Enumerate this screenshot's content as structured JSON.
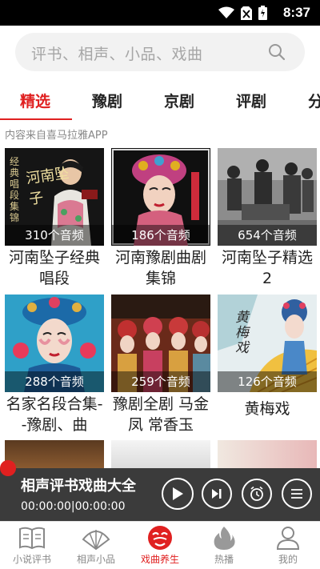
{
  "status_bar": {
    "time": "8:37"
  },
  "search": {
    "placeholder": "评书、相声、小品、戏曲"
  },
  "tabs": [
    {
      "label": "精选",
      "active": true
    },
    {
      "label": "豫剧"
    },
    {
      "label": "京剧"
    },
    {
      "label": "评剧"
    },
    {
      "label": "分"
    }
  ],
  "source_note": "内容来自喜马拉雅APP",
  "albums": [
    {
      "title": "河南坠子经典唱段",
      "count": "310个音频",
      "cover_text": "河南坠子",
      "cover_side_text": "经典唱段集锦"
    },
    {
      "title": "河南豫剧曲剧集锦",
      "count": "186个音频"
    },
    {
      "title": "河南坠子精选2",
      "count": "654个音频"
    },
    {
      "title": "名家名段合集--豫剧、曲",
      "count": "288个音频"
    },
    {
      "title": "豫剧全剧 马金凤 常香玉",
      "count": "259个音频"
    },
    {
      "title": "黄梅戏",
      "count": "126个音频",
      "cover_text": "黄梅戏"
    }
  ],
  "player": {
    "title": "相声评书戏曲大全",
    "time": "00:00:00|00:00:00"
  },
  "bottom_nav": [
    {
      "label": "小说评书",
      "icon": "book-icon"
    },
    {
      "label": "相声小品",
      "icon": "fan-icon"
    },
    {
      "label": "戏曲养生",
      "icon": "opera-mask-icon",
      "active": true
    },
    {
      "label": "热播",
      "icon": "flame-icon"
    },
    {
      "label": "我的",
      "icon": "person-icon"
    }
  ],
  "colors": {
    "accent": "#e02020",
    "player_bg": "#3b3b3b",
    "search_bg": "#f2f2f2"
  }
}
